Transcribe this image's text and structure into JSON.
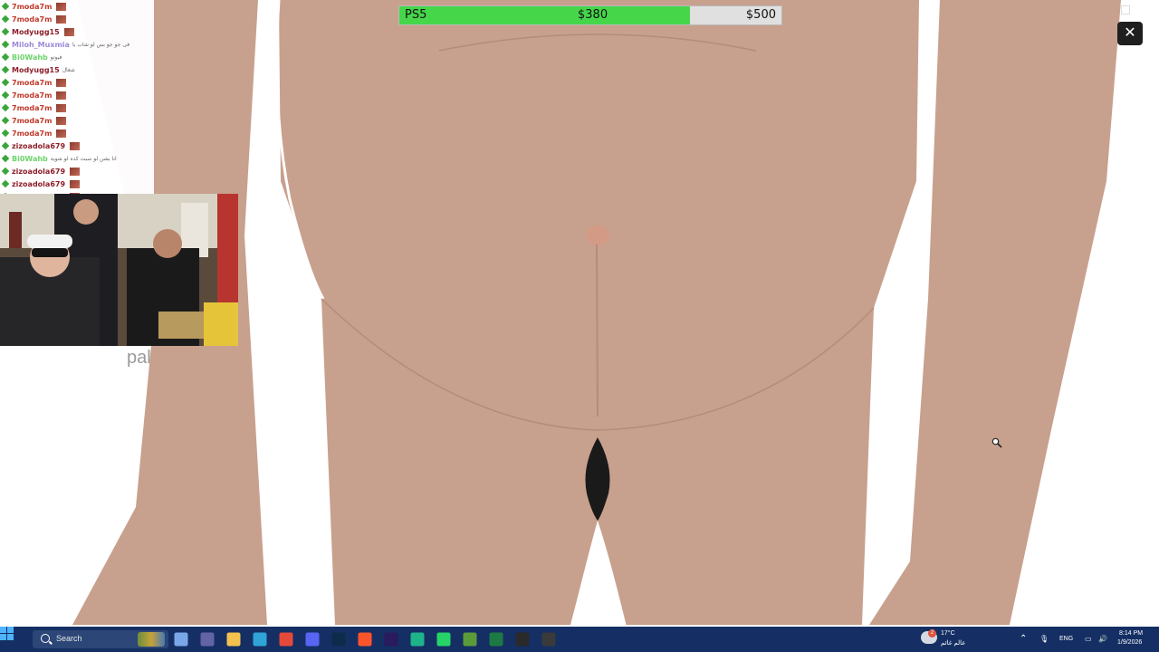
{
  "goal": {
    "label": "PS5",
    "current": "$380",
    "target": "$500",
    "progress": 0.76,
    "fill_color": "#46d64a"
  },
  "chat": {
    "messages": [
      {
        "user": "7moda7m",
        "color": "#c0392b",
        "emote": true,
        "msg": ""
      },
      {
        "user": "7moda7m",
        "color": "#c0392b",
        "emote": true,
        "msg": ""
      },
      {
        "user": "Modyugg15",
        "color": "#8e1f2b",
        "emote": true,
        "msg": ""
      },
      {
        "user": "Miloh_Muxmia",
        "color": "#9b8ad8",
        "emote": false,
        "msg": "فى جو جو بس لو شاب يا"
      },
      {
        "user": "Bi0Wahb",
        "color": "#6cd46c",
        "emote": false,
        "msg": "فيوتو"
      },
      {
        "user": "Modyugg15",
        "color": "#8e1f2b",
        "emote": false,
        "msg": "شغال"
      },
      {
        "user": "7moda7m",
        "color": "#c0392b",
        "emote": true,
        "msg": ""
      },
      {
        "user": "7moda7m",
        "color": "#c0392b",
        "emote": true,
        "msg": ""
      },
      {
        "user": "7moda7m",
        "color": "#c0392b",
        "emote": true,
        "msg": ""
      },
      {
        "user": "7moda7m",
        "color": "#c0392b",
        "emote": true,
        "msg": ""
      },
      {
        "user": "7moda7m",
        "color": "#c0392b",
        "emote": true,
        "msg": ""
      },
      {
        "user": "zizoadola679",
        "color": "#8e1f2b",
        "emote": true,
        "msg": ""
      },
      {
        "user": "Bi0Wahb",
        "color": "#6cd46c",
        "emote": false,
        "msg": "انا بشن لو سبت كده لو شوية"
      },
      {
        "user": "zizoadola679",
        "color": "#8e1f2b",
        "emote": true,
        "msg": ""
      },
      {
        "user": "zizoadola679",
        "color": "#8e1f2b",
        "emote": true,
        "msg": ""
      },
      {
        "user": "zizoadola679",
        "color": "#8e1f2b",
        "emote": true,
        "msg": ""
      }
    ]
  },
  "webcam": {
    "caption": "pal"
  },
  "window": {
    "close_symbol": "✕"
  },
  "taskbar": {
    "search_placeholder": "Search",
    "apps": [
      "widgets-icon",
      "teams-icon",
      "file-explorer-icon",
      "edge-icon",
      "chrome-icon",
      "discord-icon",
      "photoshop-icon",
      "brave-icon",
      "premiere-icon",
      "app-icon",
      "whatsapp-icon",
      "minecraft-icon",
      "excel-icon",
      "epic-games-icon",
      "obs-icon"
    ],
    "weather_badge": "2",
    "weather_temp": "17°C",
    "weather_desc": "عالم غائم",
    "language": "ENG",
    "time": "8:14 PM",
    "date": "1/9/2026"
  },
  "colors": {
    "skin": "#c8a08e",
    "skin_line": "#b78a78",
    "taskbar": "#152f64"
  }
}
